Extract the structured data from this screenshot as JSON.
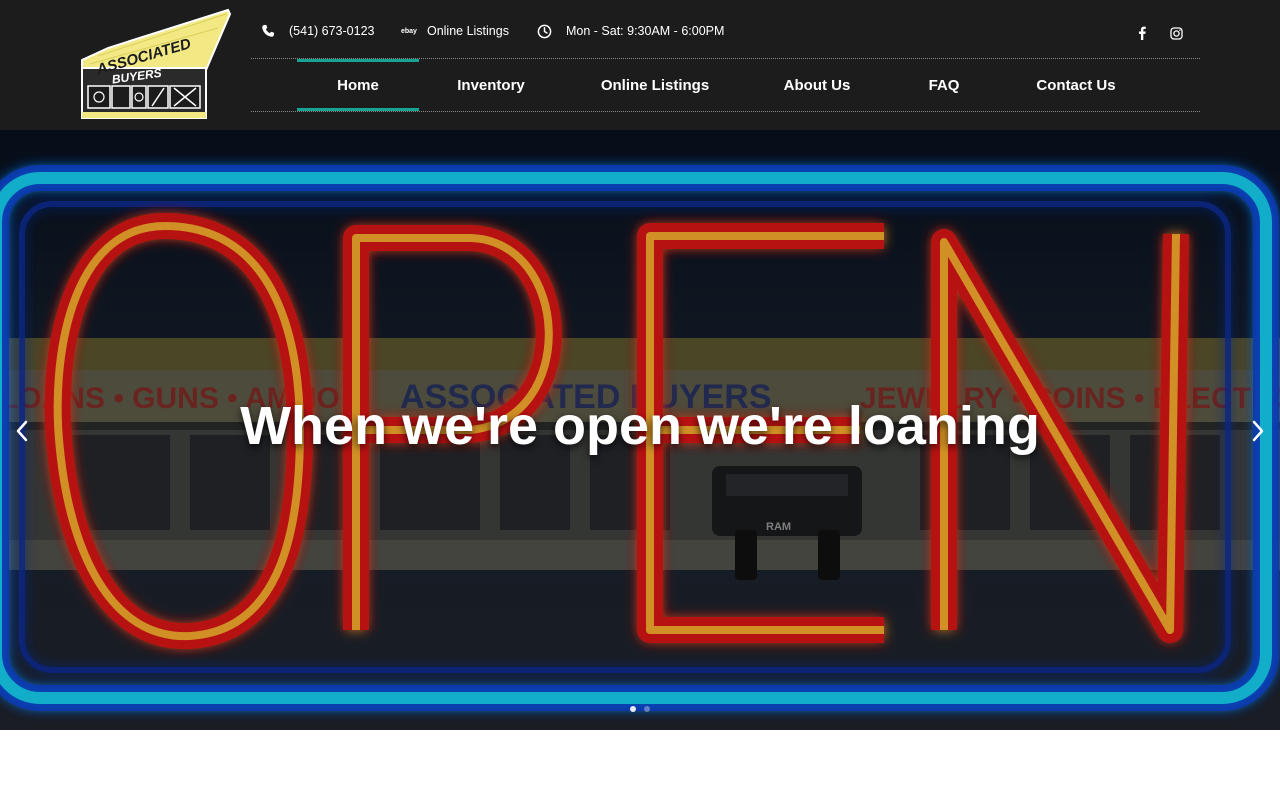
{
  "header": {
    "logo": {
      "line1": "ASSOCIATED",
      "line2": "BUYERS"
    },
    "contact": {
      "phone": "(541) 673-0123",
      "ebay_icon_text": "ebay",
      "online_listings": "Online Listings",
      "hours": "Mon - Sat: 9:30AM - 6:00PM"
    },
    "social": [
      {
        "icon": "facebook-icon"
      },
      {
        "icon": "instagram-icon"
      }
    ],
    "nav": [
      {
        "label": "Home",
        "active": true
      },
      {
        "label": "Inventory",
        "active": false
      },
      {
        "label": "Online Listings",
        "active": false
      },
      {
        "label": "About Us",
        "active": false
      },
      {
        "label": "FAQ",
        "active": false
      },
      {
        "label": "Contact Us",
        "active": false
      }
    ]
  },
  "hero": {
    "title": "When we're open we're loaning",
    "sign_text": "OPEN",
    "storefront": {
      "left_sign": "LOANS • GUNS • AMMO",
      "center_sign": "ASSOCIATED BUYERS",
      "right_sign": "JEWELRY • COINS • ELECTRO",
      "truck_badge": "RAM"
    },
    "slides": [
      {
        "active": true
      },
      {
        "active": false
      }
    ]
  },
  "colors": {
    "header_bg": "#1c1c1c",
    "accent": "#16a393",
    "neon_blue": "#19d3f5",
    "neon_red": "#ff2a1f",
    "neon_yellow": "#ffd23a"
  }
}
